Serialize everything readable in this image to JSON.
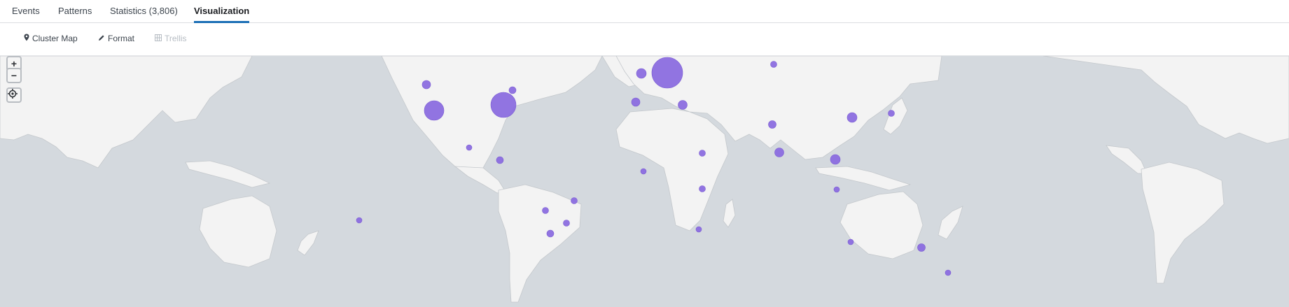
{
  "tabs": [
    {
      "label": "Events"
    },
    {
      "label": "Patterns"
    },
    {
      "label": "Statistics (3,806)"
    },
    {
      "label": "Visualization",
      "active": true
    }
  ],
  "toolbar": {
    "cluster_map": {
      "label": "Cluster Map",
      "icon": "map-pin-icon"
    },
    "format": {
      "label": "Format",
      "icon": "pencil-icon"
    },
    "trellis": {
      "label": "Trellis",
      "icon": "grid-icon",
      "disabled": true
    }
  },
  "map_controls": {
    "zoom_in": {
      "label": "+",
      "icon": "plus-icon"
    },
    "zoom_out": {
      "label": "−",
      "icon": "minus-icon"
    },
    "reset": {
      "icon": "crosshair-icon"
    }
  },
  "colors": {
    "ocean": "#d4d9de",
    "land": "#f3f3f3",
    "marker": "#8b6ddf",
    "active_tab": "#1a6eb5"
  }
}
